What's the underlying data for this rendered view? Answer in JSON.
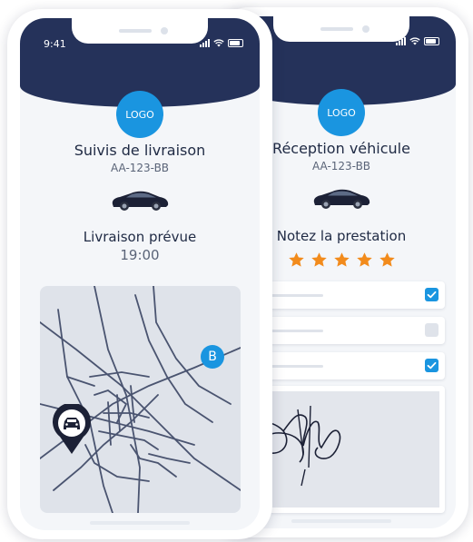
{
  "colors": {
    "header": "#25325a",
    "accent": "#1a95e0",
    "star": "#f28b1c",
    "screen": "#f4f6f9"
  },
  "tracking_screen": {
    "status_time": "9:41",
    "logo_label": "LOGO",
    "title": "Suivis de livraison",
    "plate": "AA-123-BB",
    "subtitle": "Livraison prévue",
    "eta": "19:00",
    "map": {
      "destination_marker": "B",
      "vehicle_icon": "car-pin-icon"
    }
  },
  "reception_screen": {
    "logo_label": "LOGO",
    "title": "Réception véhicule",
    "plate": "AA-123-BB",
    "rating_prompt": "Notez la prestation",
    "rating_value": 5,
    "rating_max": 5,
    "checklist": [
      {
        "checked": true
      },
      {
        "checked": false
      },
      {
        "checked": true
      }
    ],
    "signature_icon": "signature-icon"
  }
}
